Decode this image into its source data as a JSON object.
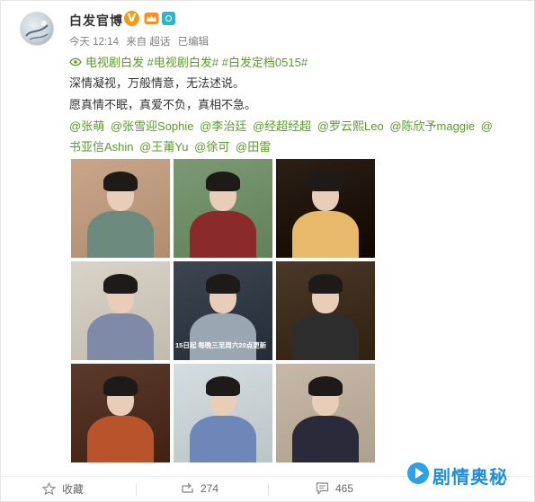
{
  "account": {
    "name": "白发官博",
    "vip_mark": "V"
  },
  "meta": {
    "time": "今天 12:14",
    "source": "来自 超话",
    "edited": "已编辑"
  },
  "topics": "电视剧白发 #电视剧白发# #白发定档0515#",
  "text_lines": [
    "深情凝视，万般情意，无法述说。",
    "愿真情不眠，真爱不负，真相不急。"
  ],
  "mentions_line1": [
    "@张萌",
    "@张雪迎Sophie",
    "@李治廷",
    "@经超经超",
    "@罗云熙Leo",
    "@陈欣予maggie",
    "@"
  ],
  "mentions_line2": [
    "书亚信Ashin",
    "@王莆Yu",
    "@徐可",
    "@田雷"
  ],
  "photos": [
    {
      "name": "photo-1",
      "bg": "#c9a58a",
      "accent": "#6d8a7e",
      "caption": ""
    },
    {
      "name": "photo-2",
      "bg": "#7b9a73",
      "accent": "#8a2a2a",
      "caption": ""
    },
    {
      "name": "photo-3",
      "bg": "#2b2016",
      "accent": "#e8b96a",
      "caption": ""
    },
    {
      "name": "photo-4",
      "bg": "#d9d3c8",
      "accent": "#7f89a8",
      "caption": ""
    },
    {
      "name": "photo-5",
      "bg": "#3d4650",
      "accent": "#9aa7b2",
      "caption": "15日起 每晚三至周六20点更新"
    },
    {
      "name": "photo-6",
      "bg": "#4a3828",
      "accent": "#2d2d2d",
      "caption": ""
    },
    {
      "name": "photo-7",
      "bg": "#5a3a2a",
      "accent": "#b8532b",
      "caption": ""
    },
    {
      "name": "photo-8",
      "bg": "#d4dde0",
      "accent": "#6f86b8",
      "caption": ""
    },
    {
      "name": "photo-9",
      "bg": "#c8b8a8",
      "accent": "#2a2a3a",
      "caption": ""
    }
  ],
  "footer": {
    "favorite_label": "收藏",
    "repost_count": "274",
    "comment_count": "465"
  },
  "watermark": {
    "text": "剧情奥秘"
  },
  "colors": {
    "link_green": "#5a9a2a",
    "vip_orange": "#f29b1a",
    "watermark_blue": "#1f8fd8"
  }
}
